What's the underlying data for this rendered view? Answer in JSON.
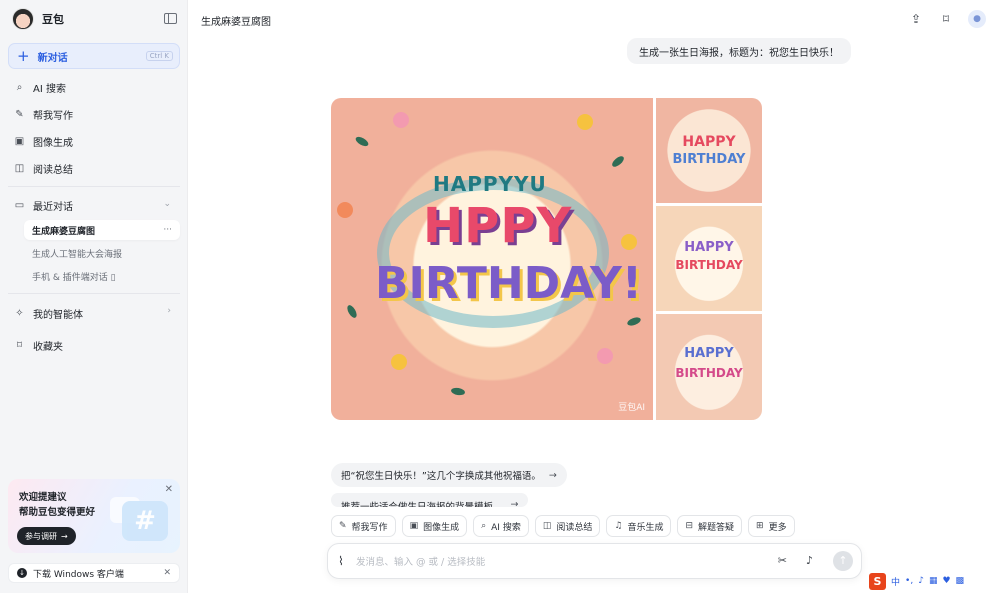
{
  "sidebar": {
    "brand": "豆包",
    "new_chat": {
      "label": "新对话",
      "shortcut": "Ctrl K"
    },
    "nav": [
      {
        "label": "AI 搜索",
        "icon": "search-icon"
      },
      {
        "label": "帮我写作",
        "icon": "pen-icon"
      },
      {
        "label": "图像生成",
        "icon": "image-icon"
      },
      {
        "label": "阅读总结",
        "icon": "book-icon"
      }
    ],
    "recent_label": "最近对话",
    "recent": [
      {
        "label": "生成麻婆豆腐图",
        "active": true
      },
      {
        "label": "生成人工智能大会海报",
        "active": false
      },
      {
        "label": "手机 & 插件端对话 ▯",
        "active": false
      }
    ],
    "agents_label": "我的智能体",
    "favorites_label": "收藏夹",
    "promo": {
      "line1": "欢迎提建议",
      "line2": "帮助豆包变得更好",
      "button": "参与调研"
    },
    "download": "下载 Windows 客户端"
  },
  "header": {
    "title": "生成麻婆豆腐图"
  },
  "conversation": {
    "user_message": "生成一张生日海报，标题为：祝您生日快乐！",
    "images": {
      "main_top": "HAPPYYU",
      "main_mid": "HPPY",
      "main_bottom": "BIRTHDAY!",
      "watermark": "豆包AI",
      "thumb1": [
        "HAPPY",
        "BIRTHDAY"
      ],
      "thumb2": [
        "HAPPY",
        "BIRTHDAY"
      ],
      "thumb3": [
        "HAPPY",
        "BIRTHDAY"
      ]
    },
    "suggestions": [
      "把“祝您生日快乐！”这几个字换成其他祝福语。",
      "推荐一些适合做生日海报的背景模板。"
    ]
  },
  "tools": [
    {
      "label": "帮我写作",
      "icon": "pen-icon"
    },
    {
      "label": "图像生成",
      "icon": "image-icon"
    },
    {
      "label": "AI 搜索",
      "icon": "search-icon"
    },
    {
      "label": "阅读总结",
      "icon": "book-icon"
    },
    {
      "label": "音乐生成",
      "icon": "music-icon"
    },
    {
      "label": "解题答疑",
      "icon": "solve-icon"
    },
    {
      "label": "更多",
      "icon": "grid-icon"
    }
  ],
  "input": {
    "placeholder": "发消息、输入 @ 或 / 选择技能"
  },
  "ime": {
    "lang": "中"
  },
  "colors": {
    "accent": "#2c5fe0",
    "sidebar_bg": "#f4f5f7",
    "new_chat_bg": "#e8eefc"
  }
}
